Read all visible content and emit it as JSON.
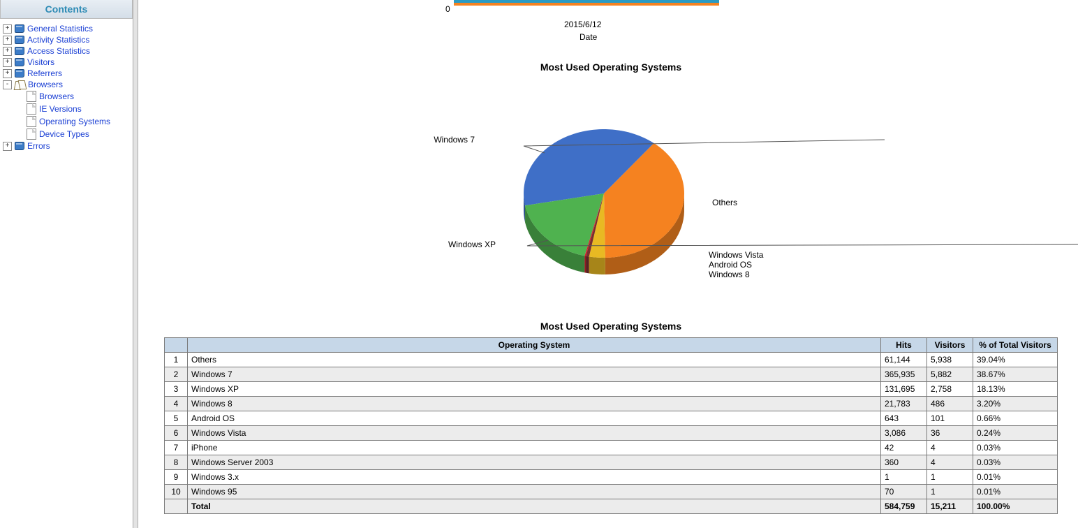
{
  "sidebar": {
    "header": "Contents",
    "items": [
      {
        "label": "General Statistics",
        "expander": "+",
        "icon": "book"
      },
      {
        "label": "Activity Statistics",
        "expander": "+",
        "icon": "book"
      },
      {
        "label": "Access Statistics",
        "expander": "+",
        "icon": "book"
      },
      {
        "label": "Visitors",
        "expander": "+",
        "icon": "book"
      },
      {
        "label": "Referrers",
        "expander": "+",
        "icon": "book"
      },
      {
        "label": "Browsers",
        "expander": "-",
        "icon": "book-open",
        "children": [
          {
            "label": "Browsers"
          },
          {
            "label": "IE Versions"
          },
          {
            "label": "Operating Systems"
          },
          {
            "label": "Device Types"
          }
        ]
      },
      {
        "label": "Errors",
        "expander": "+",
        "icon": "book"
      }
    ]
  },
  "axis_remnant": {
    "zero": "0",
    "date_tick": "2015/6/12",
    "date_label": "Date"
  },
  "chart_section_title": "Most Used Operating Systems",
  "chart_data": {
    "type": "pie",
    "title": "Most Used Operating Systems",
    "series": [
      {
        "name": "Windows 7",
        "value": 38.67,
        "color": "#3f6fc7"
      },
      {
        "name": "Others",
        "value": 39.04,
        "color": "#f58220"
      },
      {
        "name": "Windows 8",
        "value": 3.2,
        "color": "#e8b923"
      },
      {
        "name": "Android OS",
        "value": 0.66,
        "color": "#7a2e2e"
      },
      {
        "name": "Windows Vista",
        "value": 0.24,
        "color": "#d61f2c"
      },
      {
        "name": "Windows XP",
        "value": 18.13,
        "color": "#4fb24f"
      }
    ],
    "series_small_unlabeled": [
      "iPhone",
      "Windows Server 2003",
      "Windows 3.x",
      "Windows 95"
    ]
  },
  "table": {
    "title": "Most Used Operating Systems",
    "headers": [
      "",
      "Operating System",
      "Hits",
      "Visitors",
      "% of Total Visitors"
    ],
    "rows": [
      {
        "n": "1",
        "os": "Others",
        "hits": "61,144",
        "visitors": "5,938",
        "pct": "39.04%"
      },
      {
        "n": "2",
        "os": "Windows 7",
        "hits": "365,935",
        "visitors": "5,882",
        "pct": "38.67%"
      },
      {
        "n": "3",
        "os": "Windows XP",
        "hits": "131,695",
        "visitors": "2,758",
        "pct": "18.13%"
      },
      {
        "n": "4",
        "os": "Windows 8",
        "hits": "21,783",
        "visitors": "486",
        "pct": "3.20%"
      },
      {
        "n": "5",
        "os": "Android OS",
        "hits": "643",
        "visitors": "101",
        "pct": "0.66%"
      },
      {
        "n": "6",
        "os": "Windows Vista",
        "hits": "3,086",
        "visitors": "36",
        "pct": "0.24%"
      },
      {
        "n": "7",
        "os": "iPhone",
        "hits": "42",
        "visitors": "4",
        "pct": "0.03%"
      },
      {
        "n": "8",
        "os": "Windows Server 2003",
        "hits": "360",
        "visitors": "4",
        "pct": "0.03%"
      },
      {
        "n": "9",
        "os": "Windows 3.x",
        "hits": "1",
        "visitors": "1",
        "pct": "0.01%"
      },
      {
        "n": "10",
        "os": "Windows 95",
        "hits": "70",
        "visitors": "1",
        "pct": "0.01%"
      }
    ],
    "total": {
      "label": "Total",
      "hits": "584,759",
      "visitors": "15,211",
      "pct": "100.00%"
    }
  }
}
